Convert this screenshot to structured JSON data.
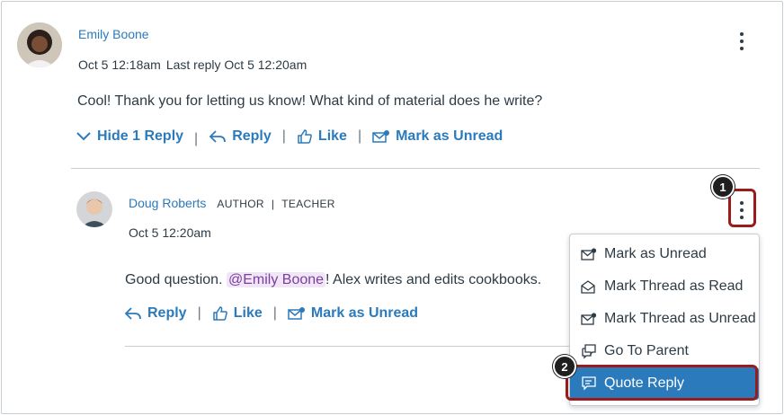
{
  "post": {
    "author": "Emily Boone",
    "timestamp": "Oct 5 12:18am",
    "last_reply": "Last reply Oct 5 12:20am",
    "message": "Cool! Thank you for letting us know! What kind of material does he write?",
    "actions": {
      "hide": "Hide 1 Reply",
      "reply": "Reply",
      "like": "Like",
      "mark_unread": "Mark as Unread"
    },
    "separator": "|"
  },
  "reply": {
    "author": "Doug Roberts",
    "role_author": "AUTHOR",
    "role_separator": "|",
    "role_teacher": "TEACHER",
    "timestamp": "Oct 5 12:20am",
    "message_before": "Good question. ",
    "mention": "@Emily Boone",
    "message_after": "! Alex writes and edits cookbooks.",
    "actions": {
      "reply": "Reply",
      "like": "Like",
      "mark_unread": "Mark as Unread"
    },
    "separator": "|"
  },
  "menu": {
    "items": [
      {
        "label": "Mark as Unread",
        "icon": "envelope-dot-icon"
      },
      {
        "label": "Mark Thread as Read",
        "icon": "envelope-open-icon"
      },
      {
        "label": "Mark Thread as Unread",
        "icon": "envelope-dot-icon"
      },
      {
        "label": "Go To Parent",
        "icon": "discussion-icon"
      },
      {
        "label": "Quote Reply",
        "icon": "quote-bubble-icon"
      }
    ],
    "active_index": 4
  },
  "callouts": {
    "badge_1": "1",
    "badge_2": "2"
  },
  "colors": {
    "link": "#2b7abc",
    "text": "#2d3b45",
    "menu_active": "#2b7abc",
    "callout": "#9b1b1b",
    "mention_bg": "#f1e6f7"
  }
}
